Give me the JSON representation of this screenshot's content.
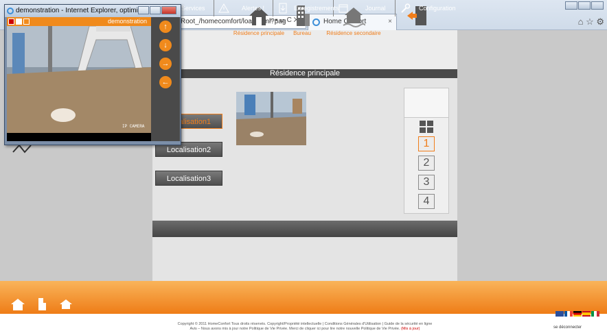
{
  "browser": {
    "address": "Root_/homecomfort/load.html?pag",
    "address_controls": "⌕ ▾ ☰ C ✕",
    "tab_title": "Home Confort",
    "tab_close": "×",
    "tools": "⌂ ☆ ⚙"
  },
  "nav": {
    "items": [
      {
        "label": "Résidence principale",
        "icon": "house-icon"
      },
      {
        "label": "Bureau",
        "icon": "office-building-icon"
      },
      {
        "label": "Résidence secondaire",
        "icon": "secondary-house-icon"
      },
      {
        "label": "",
        "icon": "logout-door-icon"
      }
    ]
  },
  "section_title": "Résidence principale",
  "locations": [
    "Localisation1",
    "Localisation2",
    "Localisation3"
  ],
  "layouts": [
    "1",
    "2",
    "3",
    "4"
  ],
  "layout_multi_label": [
    "1",
    "2",
    "3",
    "4"
  ],
  "tabs": [
    {
      "label": "Services",
      "icon": "services-icon"
    },
    {
      "label": "Alertes !",
      "icon": "alert-icon"
    },
    {
      "label": "Enregistrements",
      "icon": "recordings-icon"
    },
    {
      "label": "Journal",
      "icon": "journal-icon"
    },
    {
      "label": "Configuration",
      "icon": "wrench-icon"
    }
  ],
  "footer": {
    "copyright_line1": "Copyright © 2011 HomeConfort Tous droits réservés. Copyright/Propriété intellectuelle | Conditions Générales d'Utilisation | Guide de la sécurité en ligne",
    "copyright_line2": "Avis – Nous avons mis à jour notre Politique de Vie Privée. Merci de cliquer ici pour lire notre nouvelle Politique de Vie Privée.",
    "copyright_link": "(Mis à jour)",
    "disconnect": "se déconnecter"
  },
  "popup": {
    "title": "demonstration - Internet Explorer, optimized for ...",
    "cam_label": "demonstration",
    "cam_overlay": "IP CAMERA"
  },
  "colors": {
    "accent": "#f07d1a",
    "dark": "#4a4a4a"
  }
}
